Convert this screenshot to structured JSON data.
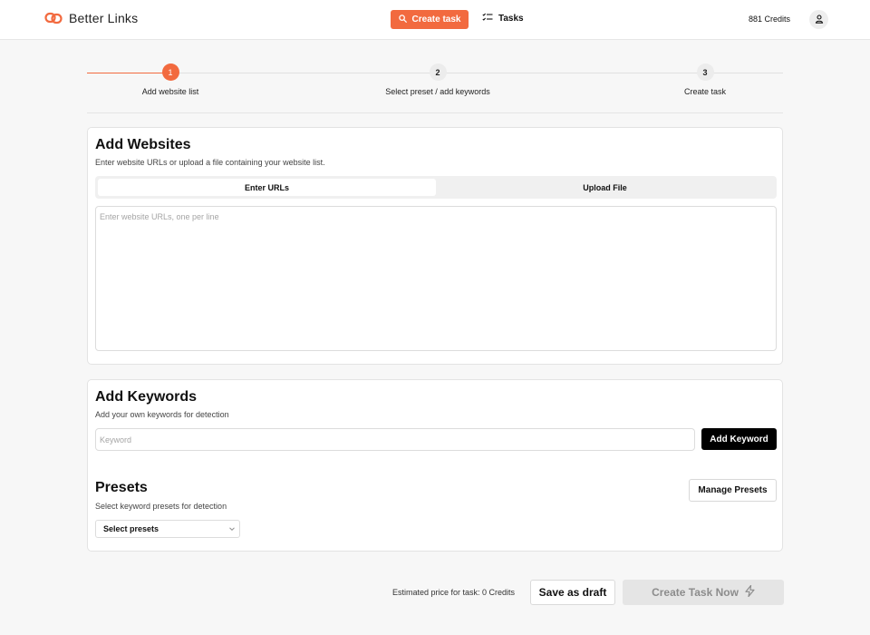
{
  "header": {
    "brand": "Better Links",
    "create_task_label": "Create task",
    "tasks_label": "Tasks",
    "credits": "881 Credits"
  },
  "stepper": {
    "steps": [
      {
        "number": "1",
        "label": "Add website list"
      },
      {
        "number": "2",
        "label": "Select preset / add keywords"
      },
      {
        "number": "3",
        "label": "Create task"
      }
    ]
  },
  "websites": {
    "title": "Add Websites",
    "subtitle": "Enter website URLs or upload a file containing your website list.",
    "tabs": [
      {
        "label": "Enter URLs"
      },
      {
        "label": "Upload File"
      }
    ],
    "textarea_placeholder": "Enter website URLs, one per line",
    "textarea_value": ""
  },
  "keywords": {
    "title": "Add Keywords",
    "subtitle": "Add your own keywords for detection",
    "input_placeholder": "Keyword",
    "input_value": "",
    "add_button": "Add Keyword"
  },
  "presets": {
    "title": "Presets",
    "subtitle": "Select keyword presets for detection",
    "manage_button": "Manage Presets",
    "select_value": "Select presets"
  },
  "footer": {
    "estimate": "Estimated price for task: 0 Credits",
    "draft_button": "Save as draft",
    "create_button": "Create Task Now"
  },
  "colors": {
    "accent": "#f26a3f",
    "primary_dark": "#000000",
    "disabled_bg": "#e5e5e5"
  },
  "icons": {
    "logo": "link-chain-icon",
    "create_task": "search-icon",
    "tasks": "checklist-icon",
    "avatar": "user-icon",
    "select": "chevron-down-icon",
    "create_now": "lightning-icon"
  }
}
